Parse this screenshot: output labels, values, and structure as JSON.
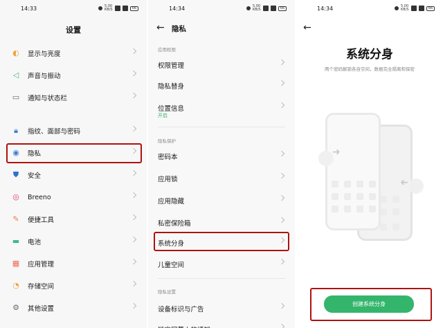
{
  "status": {
    "time1": "14:33",
    "time2": "14:34",
    "time3": "14:34",
    "net": "5.00 KB/S",
    "battery": "66"
  },
  "settings": {
    "title": "设置",
    "items": [
      {
        "label": "显示与亮度",
        "icon": "brightness-icon",
        "color": "#f2a23a"
      },
      {
        "label": "声音与振动",
        "icon": "sound-icon",
        "color": "#3fb66e"
      },
      {
        "label": "通知与状态栏",
        "icon": "notification-icon",
        "color": "#6a6a6a"
      },
      {
        "label": "指纹、面部与密码",
        "icon": "lock-icon",
        "color": "#3a7bd5"
      },
      {
        "label": "隐私",
        "icon": "privacy-eye-icon",
        "color": "#3a7bd5"
      },
      {
        "label": "安全",
        "icon": "security-shield-icon",
        "color": "#2f6fd1"
      },
      {
        "label": "Breeno",
        "icon": "breeno-icon",
        "color": "#e0457b"
      },
      {
        "label": "便捷工具",
        "icon": "tools-icon",
        "color": "#f07d3a"
      },
      {
        "label": "电池",
        "icon": "battery-icon",
        "color": "#3fb68f"
      },
      {
        "label": "应用管理",
        "icon": "apps-grid-icon",
        "color": "#ef6b5a"
      },
      {
        "label": "存储空间",
        "icon": "storage-icon",
        "color": "#f2a23a"
      },
      {
        "label": "其他设置",
        "icon": "other-settings-icon",
        "color": "#6a6a6a"
      }
    ]
  },
  "privacy": {
    "title": "隐私",
    "section1": "应用权限",
    "section2": "隐私保护",
    "section3": "隐私设置",
    "items1": [
      {
        "label": "权限管理"
      },
      {
        "label": "隐私替身"
      },
      {
        "label": "位置信息",
        "sub": "开启"
      }
    ],
    "items2": [
      {
        "label": "密码本"
      },
      {
        "label": "应用锁"
      },
      {
        "label": "应用隐藏"
      },
      {
        "label": "私密保险箱"
      },
      {
        "label": "系统分身"
      },
      {
        "label": "儿童空间"
      }
    ],
    "items3": [
      {
        "label": "设备标识与广告"
      },
      {
        "label": "锁定屏幕上的通知"
      }
    ]
  },
  "clone": {
    "title": "系统分身",
    "desc": "两个密码解锁各自空间，数据完全隔离和保密",
    "button": "创建系统分身",
    "accent": "#34b56c"
  }
}
